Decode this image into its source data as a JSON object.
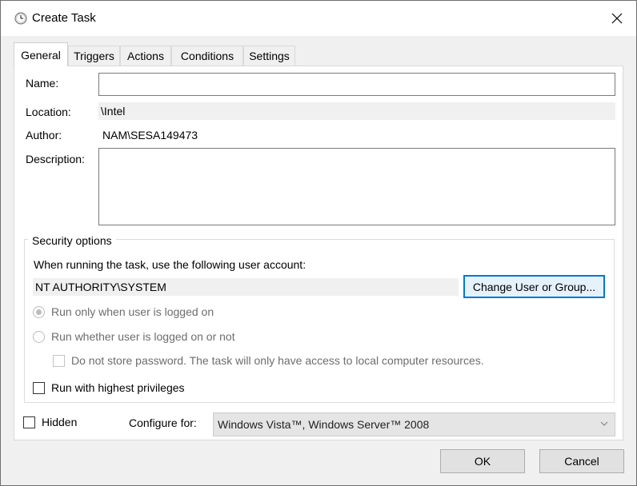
{
  "window": {
    "title": "Create Task"
  },
  "tabs": [
    {
      "label": "General",
      "active": true
    },
    {
      "label": "Triggers"
    },
    {
      "label": "Actions"
    },
    {
      "label": "Conditions"
    },
    {
      "label": "Settings"
    }
  ],
  "general": {
    "name_label": "Name:",
    "name_value": "",
    "location_label": "Location:",
    "location_value": "\\Intel",
    "author_label": "Author:",
    "author_value": "NAM\\SESA149473",
    "description_label": "Description:",
    "description_value": ""
  },
  "security": {
    "legend": "Security options",
    "account_prompt": "When running the task, use the following user account:",
    "account_value": "NT AUTHORITY\\SYSTEM",
    "change_button": "Change User or Group...",
    "radio_logged_on": "Run only when user is logged on",
    "radio_logged_on_checked": true,
    "radio_whether": "Run whether user is logged on or not",
    "no_store_password": "Do not store password.  The task will only have access to local computer resources.",
    "highest_privileges": "Run with highest privileges"
  },
  "bottom": {
    "hidden_label": "Hidden",
    "configure_label": "Configure for:",
    "configure_value": "Windows Vista™, Windows Server™ 2008"
  },
  "footer": {
    "ok": "OK",
    "cancel": "Cancel"
  },
  "colors": {
    "accent": "#0078d7",
    "disabled": "#6d6d6d"
  }
}
